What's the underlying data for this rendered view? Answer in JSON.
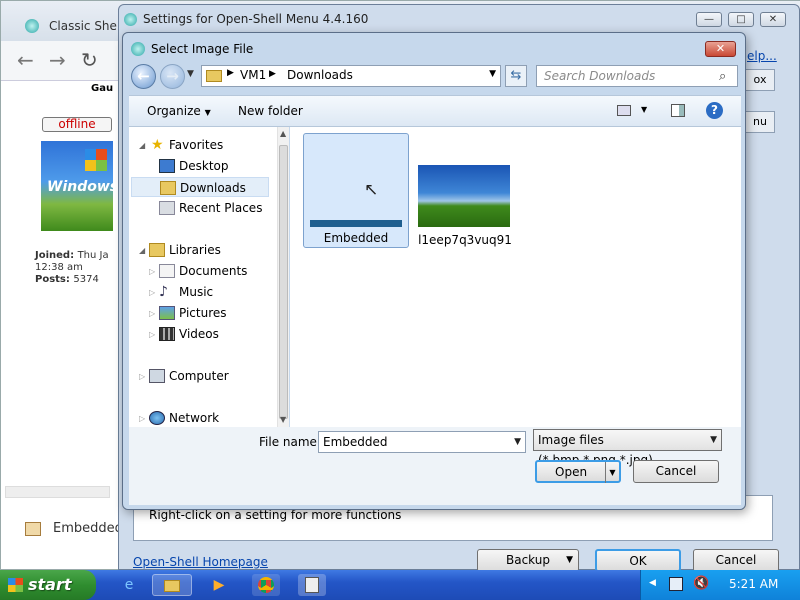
{
  "browser": {
    "tab_title": "Classic Shell",
    "column_header": "Gau",
    "status_badge": "offline",
    "logo_text": "Windows",
    "joined_label": "Joined:",
    "joined_value": "Thu Ja",
    "joined_time": "12:38 am",
    "posts_label": "Posts:",
    "posts_value": "5374",
    "attachment_label": "Embedded"
  },
  "settings": {
    "title": "Settings for Open-Shell Menu 4.4.160",
    "help_link": "elp...",
    "tab1": "ox",
    "tab2": "nu",
    "hint": "Right-click on a setting for more functions",
    "homepage_link": "Open-Shell Homepage",
    "backup_label": "Backup",
    "ok_label": "OK",
    "cancel_label": "Cancel"
  },
  "dialog": {
    "title": "Select Image File",
    "breadcrumb": [
      "VM1",
      "Downloads"
    ],
    "search_placeholder": "Search Downloads",
    "organize_label": "Organize",
    "new_folder_label": "New folder",
    "nav": {
      "favorites": "Favorites",
      "desktop": "Desktop",
      "downloads": "Downloads",
      "recent": "Recent Places",
      "libraries": "Libraries",
      "documents": "Documents",
      "music": "Music",
      "pictures": "Pictures",
      "videos": "Videos",
      "computer": "Computer",
      "network": "Network"
    },
    "files": [
      {
        "name": "Embedded",
        "selected": true
      },
      {
        "name": "l1eep7q3vuq91",
        "selected": false
      }
    ],
    "filename_label": "File name:",
    "filename_value": "Embedded",
    "filetype_value": "Image files (*.bmp,*.png,*.jpg)",
    "open_label": "Open",
    "cancel_label": "Cancel"
  },
  "taskbar": {
    "start_label": "start",
    "clock": "5:21 AM"
  }
}
